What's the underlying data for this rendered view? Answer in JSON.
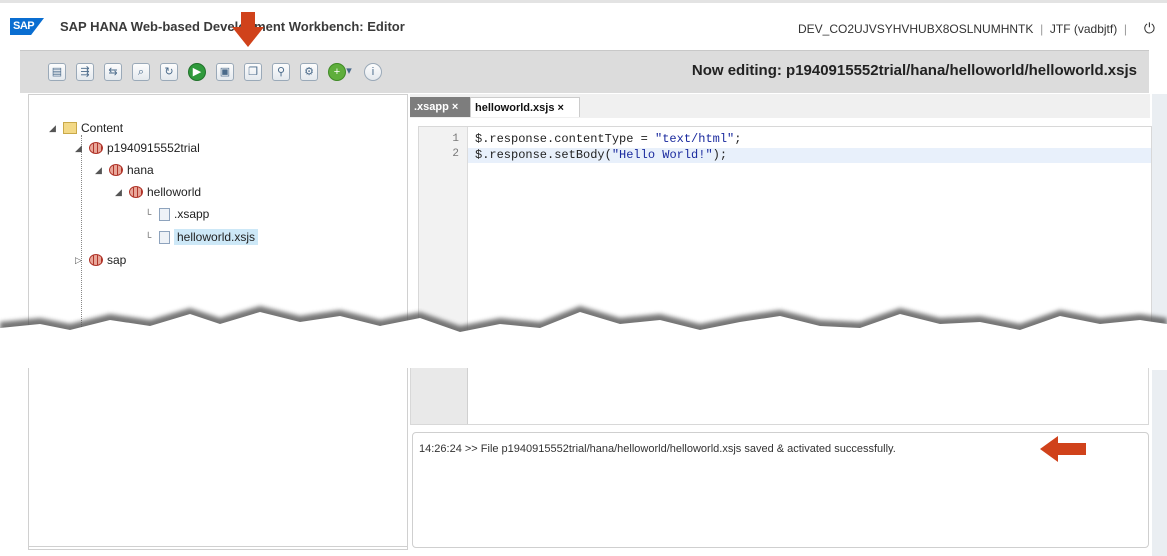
{
  "header": {
    "logo_text": "SAP",
    "title": "SAP HANA Web-based Development Workbench: Editor",
    "system": "DEV_CO2UJVSYHVHUBX8OSLNUMHNTK",
    "user": "JTF (vadbjtf)",
    "separator": "|"
  },
  "toolbar": {
    "icons": [
      "new-file-icon",
      "import-icon",
      "export-icon",
      "search-replace-icon",
      "refresh-icon",
      "run-icon",
      "save-icon",
      "copy-icon",
      "find-icon",
      "settings-icon",
      "add-icon",
      "info-icon"
    ],
    "editing_label": "Now editing: p1940915552trial/hana/helloworld/helloworld.xsjs"
  },
  "tree": {
    "root": "Content",
    "package_trial": "p1940915552trial",
    "package_hana": "hana",
    "package_helloworld": "helloworld",
    "file_xsapp": ".xsapp",
    "file_xsjs": "helloworld.xsjs",
    "package_sap": "sap"
  },
  "tabs": {
    "xsapp": ".xsapp",
    "hello": "helloworld.xsjs",
    "close_glyph": "×"
  },
  "code": {
    "line_numbers": [
      "1",
      "2"
    ],
    "line1_prefix": "$.response.contentType = ",
    "line1_string": "\"text/html\"",
    "line1_suffix": ";",
    "line2_prefix": "$.response.setBody(",
    "line2_string": "\"Hello World!\"",
    "line2_suffix": ");"
  },
  "console": {
    "message": "14:26:24 >> File p1940915552trial/hana/helloworld/helloworld.xsjs saved & activated successfully."
  },
  "colors": {
    "accent": "#d0421b",
    "brand": "#0a6ed1",
    "selection": "#cde8f7"
  }
}
